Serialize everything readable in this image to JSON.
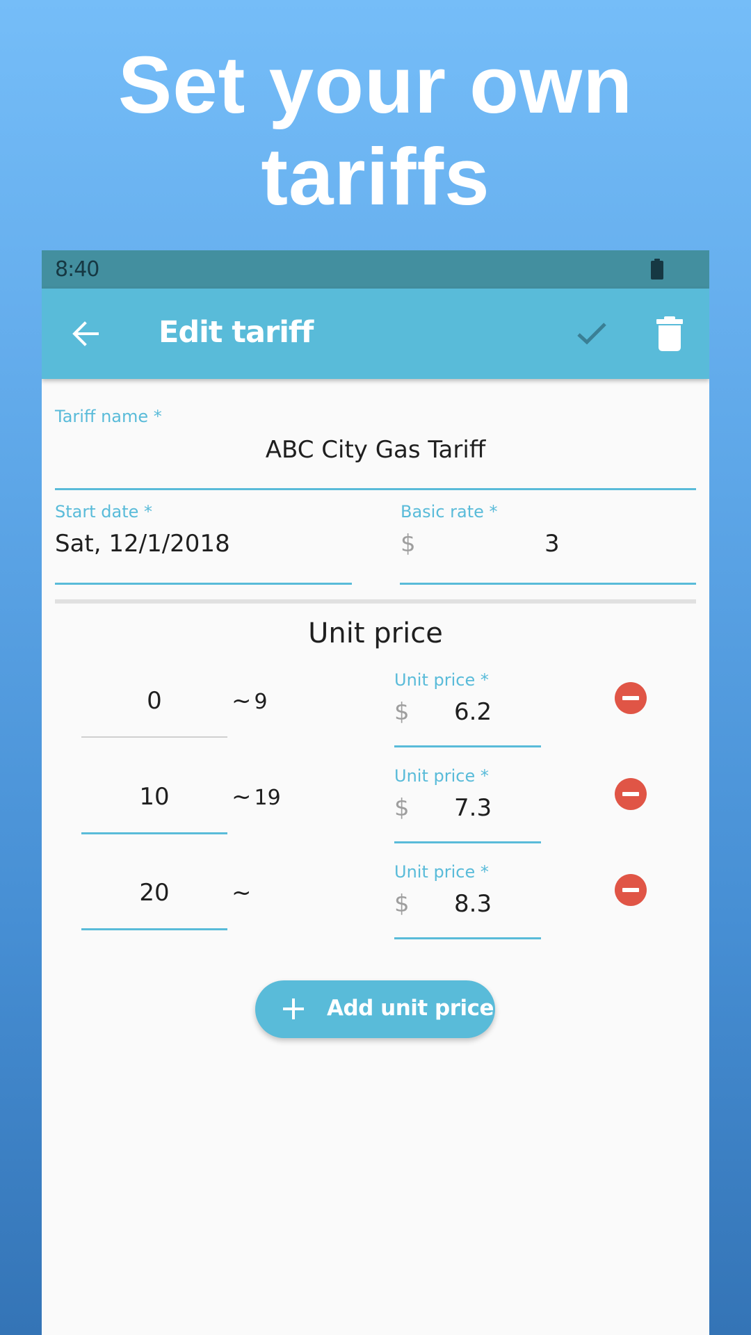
{
  "promo": {
    "headline_line1": "Set your own",
    "headline_line2": "tariffs"
  },
  "status_bar": {
    "time": "8:40",
    "battery_icon": "battery-full-icon"
  },
  "app_bar": {
    "title": "Edit tariff",
    "back_icon": "arrow-back-icon",
    "save_icon": "check-icon",
    "delete_icon": "trash-icon"
  },
  "form": {
    "tariff_name": {
      "label": "Tariff name *",
      "value": "ABC City Gas Tariff"
    },
    "start_date": {
      "label": "Start date *",
      "value": "Sat, 12/1/2018"
    },
    "basic_rate": {
      "label": "Basic rate *",
      "prefix": "$",
      "value": "3"
    }
  },
  "unit_price": {
    "title": "Unit price",
    "rows": [
      {
        "from": "0",
        "tilde": "~",
        "to": "9",
        "price_label": "Unit price *",
        "prefix": "$",
        "price": "6.2"
      },
      {
        "from": "10",
        "tilde": "~",
        "to": "19",
        "price_label": "Unit price *",
        "prefix": "$",
        "price": "7.3"
      },
      {
        "from": "20",
        "tilde": "~",
        "to": "",
        "price_label": "Unit price *",
        "prefix": "$",
        "price": "8.3"
      }
    ],
    "add_button_label": "Add unit price"
  },
  "colors": {
    "primary": "#59bbd9",
    "status_bar": "#438f9f",
    "remove": "#e05546",
    "background_top": "#75bdf8",
    "background_bottom": "#3474b6"
  }
}
